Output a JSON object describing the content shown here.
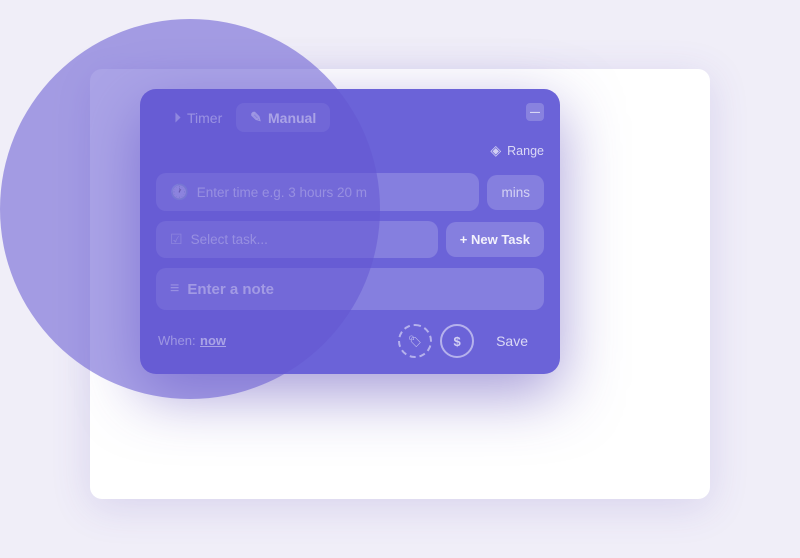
{
  "tabs": {
    "timer": {
      "label": "Timer",
      "icon": "⏵"
    },
    "manual": {
      "label": "Manual",
      "icon": "✎"
    }
  },
  "minimize_btn": "—",
  "range_label": "Range",
  "time_input": {
    "placeholder": "Enter time e.g. 3 hours 20 m",
    "suffix": "mins"
  },
  "task_input": {
    "placeholder": "Select task..."
  },
  "new_task_btn": "+ New Task",
  "note_input": {
    "placeholder": "Enter a note"
  },
  "when": {
    "label": "When:",
    "value": "now"
  },
  "save_btn": "Save",
  "icons": {
    "clock": "🕐",
    "task_check": "☑",
    "note_lines": "≡",
    "tag": "🏷",
    "dollar": "$",
    "range_icon": "◈"
  }
}
